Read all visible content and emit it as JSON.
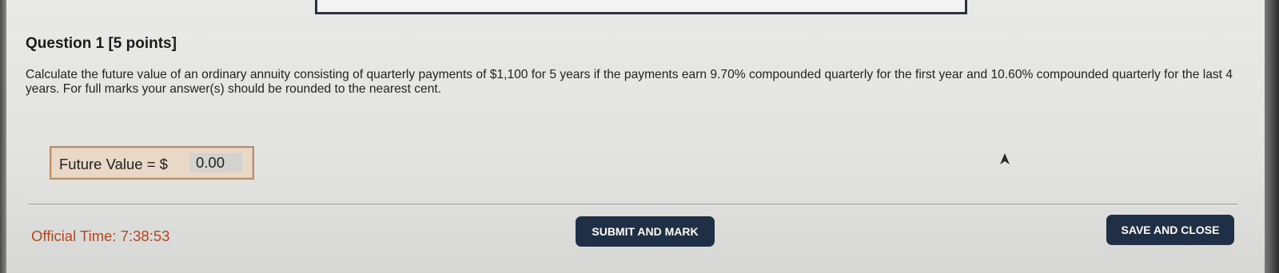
{
  "question": {
    "title": "Question 1 [5 points]",
    "body": "Calculate the future value of an ordinary annuity consisting of quarterly payments of $1,100 for 5 years if the payments earn 9.70% compounded quarterly for the first year and 10.60% compounded quarterly for the last 4 years. For full marks your answer(s) should be rounded to the nearest cent."
  },
  "answer": {
    "label": "Future Value = $",
    "value": "0.00"
  },
  "footer": {
    "official_time": "Official Time: 7:38:53",
    "submit_label": "SUBMIT AND MARK",
    "save_label": "SAVE AND CLOSE"
  },
  "colors": {
    "button_bg": "#1f2f45",
    "time_text": "#b2461f",
    "answer_box_bg": "#e9d8c6",
    "answer_box_border": "#b88e67"
  },
  "icons": {
    "pointer": "mouse-pointer-icon"
  }
}
